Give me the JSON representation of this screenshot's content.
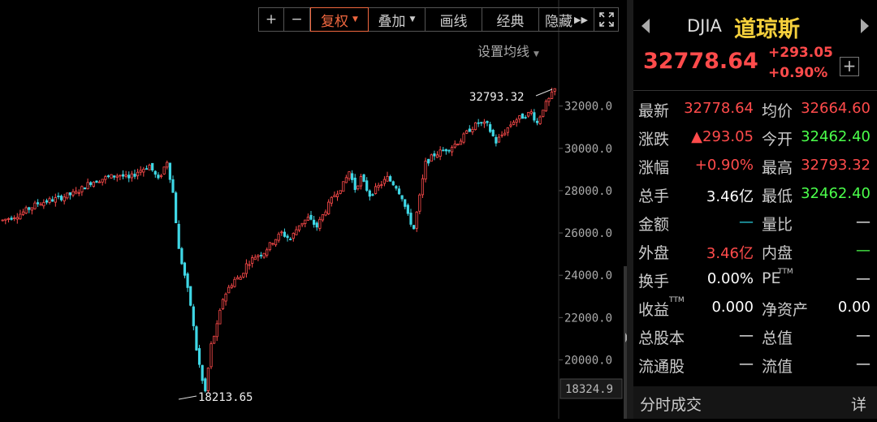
{
  "toolbar": {
    "zoom_in": "+",
    "zoom_out": "−",
    "restore_right": "复权",
    "overlay": "叠加",
    "draw_line": "画线",
    "classic": "经典",
    "hide": "隐藏",
    "ma_setting": "设置均线"
  },
  "chart_data": {
    "type": "candlestick",
    "y_ticks": [
      "32000.0",
      "30000.0",
      "28000.0",
      "26000.0",
      "24000.0",
      "22000.0",
      "20000.0"
    ],
    "y_tick_values": [
      32000,
      30000,
      28000,
      26000,
      24000,
      22000,
      20000
    ],
    "ylim": [
      18324.9,
      32793.32
    ],
    "y_bottom_label": "18324.9",
    "high_annotation": "32793.32",
    "low_annotation": "18213.65",
    "trend": [
      [
        0,
        26600
      ],
      [
        6,
        26900
      ],
      [
        12,
        27400
      ],
      [
        18,
        27600
      ],
      [
        25,
        27900
      ],
      [
        30,
        28400
      ],
      [
        35,
        28600
      ],
      [
        40,
        28750
      ],
      [
        43,
        28550
      ],
      [
        46,
        28900
      ],
      [
        50,
        29200
      ],
      [
        53,
        28500
      ],
      [
        56,
        29400
      ],
      [
        58,
        27900
      ],
      [
        60,
        25200
      ],
      [
        62,
        24000
      ],
      [
        64,
        22600
      ],
      [
        66,
        20500
      ],
      [
        68,
        19000
      ],
      [
        69,
        18500
      ],
      [
        71,
        20700
      ],
      [
        73,
        21600
      ],
      [
        75,
        22900
      ],
      [
        77,
        23400
      ],
      [
        79,
        23800
      ],
      [
        81,
        23900
      ],
      [
        83,
        24500
      ],
      [
        86,
        24900
      ],
      [
        89,
        25100
      ],
      [
        92,
        25600
      ],
      [
        95,
        26000
      ],
      [
        98,
        25700
      ],
      [
        101,
        26400
      ],
      [
        104,
        26700
      ],
      [
        107,
        26300
      ],
      [
        110,
        27100
      ],
      [
        113,
        27800
      ],
      [
        116,
        28300
      ],
      [
        118,
        28900
      ],
      [
        120,
        28100
      ],
      [
        122,
        28600
      ],
      [
        125,
        27800
      ],
      [
        128,
        28200
      ],
      [
        131,
        28600
      ],
      [
        134,
        28200
      ],
      [
        136,
        27700
      ],
      [
        138,
        26800
      ],
      [
        140,
        26200
      ],
      [
        142,
        27700
      ],
      [
        144,
        29300
      ],
      [
        147,
        29700
      ],
      [
        150,
        29900
      ],
      [
        153,
        30100
      ],
      [
        156,
        30400
      ],
      [
        159,
        30900
      ],
      [
        162,
        31200
      ],
      [
        165,
        31100
      ],
      [
        168,
        30300
      ],
      [
        171,
        30800
      ],
      [
        174,
        31300
      ],
      [
        177,
        31500
      ],
      [
        180,
        31700
      ],
      [
        182,
        31200
      ],
      [
        184,
        31900
      ],
      [
        186,
        32300
      ],
      [
        188,
        32779
      ]
    ]
  },
  "panel": {
    "code": "DJIA",
    "name": "道琼斯",
    "price": "32778.64",
    "change": "+293.05",
    "change_pct": "+0.90%",
    "add": "+",
    "rows": [
      {
        "l1": "最新",
        "v1": "32778.64",
        "c1": "red",
        "l2": "均价",
        "v2": "32664.60",
        "c2": "red"
      },
      {
        "l1": "涨跌",
        "v1": "▲293.05",
        "c1": "red",
        "l2": "今开",
        "v2": "32462.40",
        "c2": "green"
      },
      {
        "l1": "涨幅",
        "v1": "+0.90%",
        "c1": "red",
        "l2": "最高",
        "v2": "32793.32",
        "c2": "red"
      },
      {
        "l1": "总手",
        "v1": "3.46亿",
        "c1": "white",
        "l2": "最低",
        "v2": "32462.40",
        "c2": "green"
      },
      {
        "l1": "金额",
        "v1": "—",
        "c1": "cyan",
        "l2": "量比",
        "v2": "—",
        "c2": "white"
      },
      {
        "l1": "外盘",
        "v1": "3.46亿",
        "c1": "red",
        "l2": "内盘",
        "v2": "—",
        "c2": "green"
      },
      {
        "l1": "换手",
        "v1": "0.00%",
        "c1": "white",
        "l2": "PE",
        "v2": "—",
        "c2": "white"
      },
      {
        "l1": "收益",
        "v1": "0.000",
        "c1": "white",
        "l2": "净资产",
        "v2": "0.00",
        "c2": "white"
      },
      {
        "l1": "总股本",
        "v1": "—",
        "c1": "white",
        "l2": "总值",
        "v2": "—",
        "c2": "white"
      },
      {
        "l1": "流通股",
        "v1": "—",
        "c1": "white",
        "l2": "流值",
        "v2": "—",
        "c2": "white"
      }
    ],
    "superscript_ttm": "TTM",
    "footer_title": "分时成交",
    "footer_detail": "详"
  }
}
